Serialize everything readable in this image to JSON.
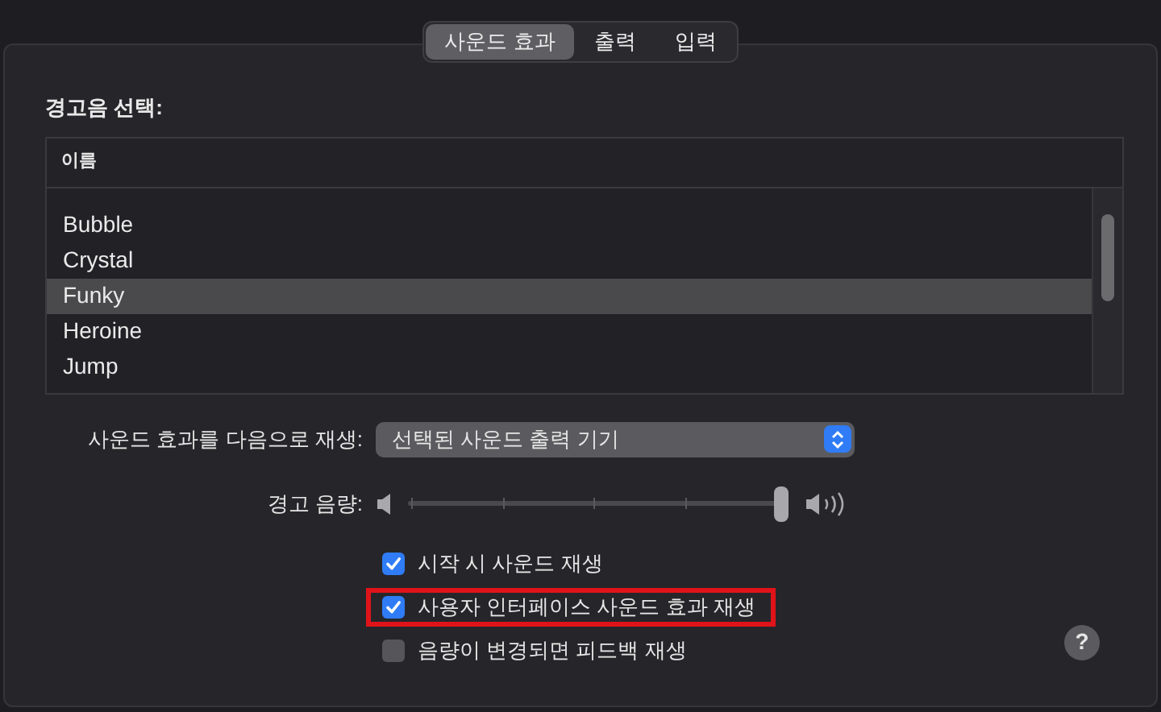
{
  "tabs": [
    {
      "label": "사운드 효과",
      "selected": true
    },
    {
      "label": "출력",
      "selected": false
    },
    {
      "label": "입력",
      "selected": false
    }
  ],
  "alert_section": {
    "title": "경고음 선택:",
    "table": {
      "columns": [
        "이름"
      ],
      "rows": [
        {
          "name": "Bubble",
          "selected": false
        },
        {
          "name": "Crystal",
          "selected": false
        },
        {
          "name": "Funky",
          "selected": true
        },
        {
          "name": "Heroine",
          "selected": false
        },
        {
          "name": "Jump",
          "selected": false
        }
      ]
    }
  },
  "play_through": {
    "label": "사운드 효과를 다음으로 재생:",
    "value": "선택된 사운드 출력 기기"
  },
  "alert_volume": {
    "label": "경고 음량:",
    "level": 1
  },
  "options": [
    {
      "label": "시작 시 사운드 재생",
      "checked": true,
      "highlighted": false
    },
    {
      "label": "사용자 인터페이스 사운드 효과 재생",
      "checked": true,
      "highlighted": true
    },
    {
      "label": "음량이 변경되면 피드백 재생",
      "checked": false,
      "highlighted": false
    }
  ],
  "help_button": {
    "label": "?"
  }
}
